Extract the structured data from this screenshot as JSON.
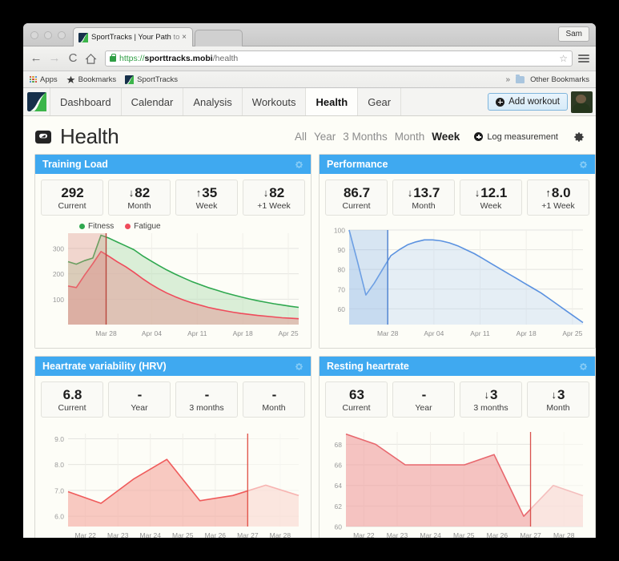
{
  "browser": {
    "tab_title_main": "SportTracks | Your Path",
    "tab_title_dim": " to",
    "tab_close": "×",
    "profile_label": "Sam",
    "back_icon": "←",
    "forward_icon": "→",
    "reload_icon": "C",
    "home_icon": "⌂",
    "url_scheme": "https://",
    "url_host": "sporttracks.mobi",
    "url_path": "/health",
    "star_icon": "☆",
    "bookmarks": [
      {
        "label": "Apps",
        "icon": "apps-grid-icon"
      },
      {
        "label": "Bookmarks",
        "icon": "star-icon"
      },
      {
        "label": "SportTracks",
        "icon": "sporttracks-favicon"
      }
    ],
    "overflow_icon": "»",
    "other_bookmarks": "Other Bookmarks"
  },
  "appnav": {
    "logo": "sporttracks-logo",
    "items": [
      {
        "label": "Dashboard",
        "active": false
      },
      {
        "label": "Calendar",
        "active": false
      },
      {
        "label": "Analysis",
        "active": false
      },
      {
        "label": "Workouts",
        "active": false
      },
      {
        "label": "Health",
        "active": true
      },
      {
        "label": "Gear",
        "active": false
      }
    ],
    "add_workout": "Add workout",
    "avatar": "user-avatar"
  },
  "page": {
    "title": "Health",
    "title_icon": "weight-scale-icon",
    "ranges": [
      {
        "label": "All",
        "selected": false
      },
      {
        "label": "Year",
        "selected": false
      },
      {
        "label": "3 Months",
        "selected": false
      },
      {
        "label": "Month",
        "selected": false
      },
      {
        "label": "Week",
        "selected": true
      }
    ],
    "log_measurement": "Log measurement",
    "settings_icon": "gear-icon"
  },
  "panels": {
    "training_load": {
      "title": "Training Load",
      "gear_icon": "gear-icon",
      "stats": [
        {
          "arrow": "",
          "value": "292",
          "label": "Current"
        },
        {
          "arrow": "↓",
          "value": "82",
          "label": "Month"
        },
        {
          "arrow": "↑",
          "value": "35",
          "label": "Week"
        },
        {
          "arrow": "↓",
          "value": "82",
          "label": "+1 Week"
        }
      ],
      "legend": [
        {
          "label": "Fitness",
          "color": "#2fa84f"
        },
        {
          "label": "Fatigue",
          "color": "#ef4b5b"
        }
      ]
    },
    "performance": {
      "title": "Performance",
      "gear_icon": "gear-icon",
      "stats": [
        {
          "arrow": "",
          "value": "86.7",
          "label": "Current"
        },
        {
          "arrow": "↓",
          "value": "13.7",
          "label": "Month"
        },
        {
          "arrow": "↓",
          "value": "12.1",
          "label": "Week"
        },
        {
          "arrow": "↑",
          "value": "8.0",
          "label": "+1 Week"
        }
      ]
    },
    "hrv": {
      "title": "Heartrate variability (HRV)",
      "gear_icon": "gear-icon",
      "stats": [
        {
          "arrow": "",
          "value": "6.8",
          "label": "Current"
        },
        {
          "arrow": "",
          "value": "-",
          "label": "Year"
        },
        {
          "arrow": "",
          "value": "-",
          "label": "3 months"
        },
        {
          "arrow": "",
          "value": "-",
          "label": "Month"
        }
      ]
    },
    "resting_hr": {
      "title": "Resting heartrate",
      "gear_icon": "gear-icon",
      "stats": [
        {
          "arrow": "",
          "value": "63",
          "label": "Current"
        },
        {
          "arrow": "",
          "value": "-",
          "label": "Year"
        },
        {
          "arrow": "↓",
          "value": "3",
          "label": "3 months"
        },
        {
          "arrow": "↓",
          "value": "3",
          "label": "Month"
        }
      ]
    }
  },
  "chart_data": [
    {
      "id": "training-load",
      "type": "area",
      "title": "Training Load",
      "xlabel": "",
      "ylabel": "",
      "ylim": [
        0,
        360
      ],
      "yticks": [
        100,
        200,
        300
      ],
      "xticks": [
        "Mar 28",
        "Apr 04",
        "Apr 11",
        "Apr 18",
        "Apr 25"
      ],
      "grid": true,
      "legend": [
        "Fitness",
        "Fatigue"
      ],
      "legend_position": "top-left",
      "today_marker": "Mar 28",
      "series": [
        {
          "name": "Fitness",
          "color": "#2fa84f",
          "fill": "#b8e0b8",
          "values": [
            248,
            238,
            252,
            262,
            352,
            340,
            325,
            310,
            295,
            272,
            252,
            233,
            215,
            199,
            184,
            170,
            158,
            146,
            136,
            126,
            117,
            109,
            101,
            94,
            88,
            82,
            77,
            72,
            68
          ]
        },
        {
          "name": "Fatigue",
          "color": "#ef4b5b",
          "fill": "#e0a79f",
          "values": [
            152,
            146,
            195,
            240,
            288,
            268,
            247,
            228,
            206,
            182,
            160,
            141,
            124,
            110,
            97,
            86,
            77,
            68,
            61,
            55,
            49,
            44,
            40,
            36,
            33,
            30,
            27,
            25,
            23
          ]
        }
      ]
    },
    {
      "id": "performance",
      "type": "area",
      "title": "Performance",
      "xlabel": "",
      "ylabel": "",
      "ylim": [
        52,
        100
      ],
      "yticks": [
        60,
        70,
        80,
        90,
        100
      ],
      "xticks": [
        "Mar 28",
        "Apr 04",
        "Apr 11",
        "Apr 18",
        "Apr 25"
      ],
      "grid": true,
      "today_marker": "Mar 28",
      "series": [
        {
          "name": "Performance",
          "color": "#5b92e0",
          "fill": "#bcd6f2",
          "values": [
            100,
            84,
            67,
            73,
            80,
            87,
            90,
            92.5,
            94,
            95,
            95,
            94.5,
            93.5,
            92,
            90,
            88,
            85.5,
            83,
            80.5,
            78,
            75.5,
            73,
            70.5,
            68,
            65,
            62,
            59,
            56,
            53
          ]
        }
      ]
    },
    {
      "id": "hrv",
      "type": "area",
      "title": "Heartrate variability (HRV)",
      "xlabel": "",
      "ylabel": "",
      "ylim": [
        5.6,
        9.2
      ],
      "yticks": [
        6.0,
        7.0,
        8.0,
        9.0
      ],
      "xticks": [
        "Mar 22",
        "Mar 23",
        "Mar 24",
        "Mar 25",
        "Mar 26",
        "Mar 27",
        "Mar 28"
      ],
      "grid": true,
      "today_marker": "Mar 27",
      "series": [
        {
          "name": "HRV",
          "color": "#ef5b5b",
          "fill": "#f5a9a0",
          "values": [
            6.95,
            6.5,
            7.45,
            8.2,
            6.6,
            6.8,
            7.2,
            6.8
          ]
        }
      ]
    },
    {
      "id": "resting-heartrate",
      "type": "area",
      "title": "Resting heartrate",
      "xlabel": "",
      "ylabel": "",
      "ylim": [
        60,
        69.2
      ],
      "yticks": [
        60,
        62,
        64,
        66,
        68
      ],
      "xticks": [
        "Mar 22",
        "Mar 23",
        "Mar 24",
        "Mar 25",
        "Mar 26",
        "Mar 27",
        "Mar 28"
      ],
      "grid": true,
      "today_marker": "Mar 27",
      "series": [
        {
          "name": "Resting heartrate",
          "color": "#e8686e",
          "fill": "#f0a0a0",
          "values": [
            69,
            68,
            66,
            66,
            66,
            67,
            61,
            64,
            63
          ]
        }
      ]
    }
  ]
}
